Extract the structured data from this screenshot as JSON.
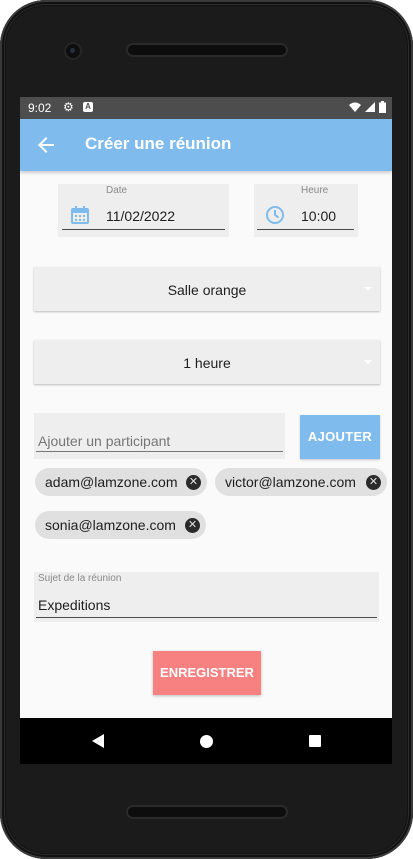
{
  "status_bar": {
    "time": "9:02",
    "settings_icon": "gear-icon",
    "notification_icon": "a-icon"
  },
  "app_bar": {
    "title": "Créer une réunion",
    "back_icon": "arrow-back-icon"
  },
  "date_field": {
    "label": "Date",
    "value": "11/02/2022",
    "icon": "calendar-icon"
  },
  "time_field": {
    "label": "Heure",
    "value": "10:00",
    "icon": "clock-icon"
  },
  "room_spinner": {
    "value": "Salle orange"
  },
  "duration_spinner": {
    "value": "1 heure"
  },
  "participant_input": {
    "placeholder": "Ajouter un participant",
    "value": ""
  },
  "add_button": {
    "label": "AJOUTER"
  },
  "participants": [
    "adam@lamzone.com",
    "victor@lamzone.com",
    "sonia@lamzone.com"
  ],
  "subject_field": {
    "label": "Sujet de la réunion",
    "value": "Expeditions"
  },
  "save_button": {
    "label": "ENREGISTRER"
  },
  "colors": {
    "accent": "#7fbbec",
    "save": "#f78181",
    "status_bar": "#4d4d4d"
  }
}
